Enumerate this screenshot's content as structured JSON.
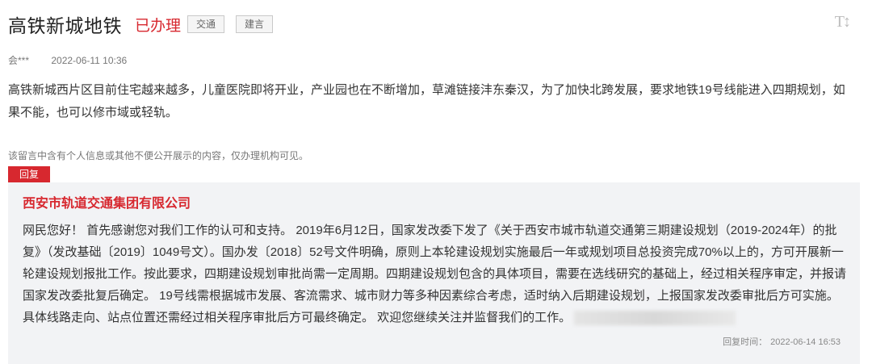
{
  "header": {
    "title": "高铁新城地铁",
    "status": "已办理",
    "tags": [
      "交通",
      "建言"
    ]
  },
  "meta": {
    "author": "会***",
    "date": "2022-06-11 10:36"
  },
  "message": {
    "content": "高铁新城西片区目前住宅越来越多，儿童医院即将开业，产业园也在不断增加，草滩链接沣东秦汉，为了加快北跨发展，要求地铁19号线能进入四期规划，如果不能，也可以修市域或轻轨。",
    "privacy_notice": "该留言中含有个人信息或其他不便公开展示的内容，仅办理机构可见。"
  },
  "reply": {
    "label": "回复",
    "organization": "西安市轨道交通集团有限公司",
    "text": "网民您好！ 首先感谢您对我们工作的认可和支持。 2019年6月12日，国家发改委下发了《关于西安市城市轨道交通第三期建设规划（2019-2024年）的批复》（发改基础〔2019〕1049号文）。国办发〔2018〕52号文件明确，原则上本轮建设规划实施最后一年或规划项目总投资完成70%以上的，方可开展新一轮建设规划报批工作。按此要求，四期建设规划审批尚需一定周期。四期建设规划包含的具体项目，需要在选线研究的基础上，经过相关程序审定，并报请国家发改委批复后确定。 19号线需根据城市发展、客流需求、城市财力等多种因素综合考虑，适时纳入后期建设规划，上报国家发改委审批后方可实施。具体线路走向、站点位置还需经过相关程序审批后方可最终确定。 欢迎您继续关注并监督我们的工作。",
    "time_label": "回复时间：",
    "time": "2022-06-14 16:53"
  },
  "watermark": "荣耀渭南网",
  "icons": {
    "font_size": "font-size-icon"
  },
  "colors": {
    "accent": "#d7282f",
    "reply_bg": "#f2f3f5"
  }
}
